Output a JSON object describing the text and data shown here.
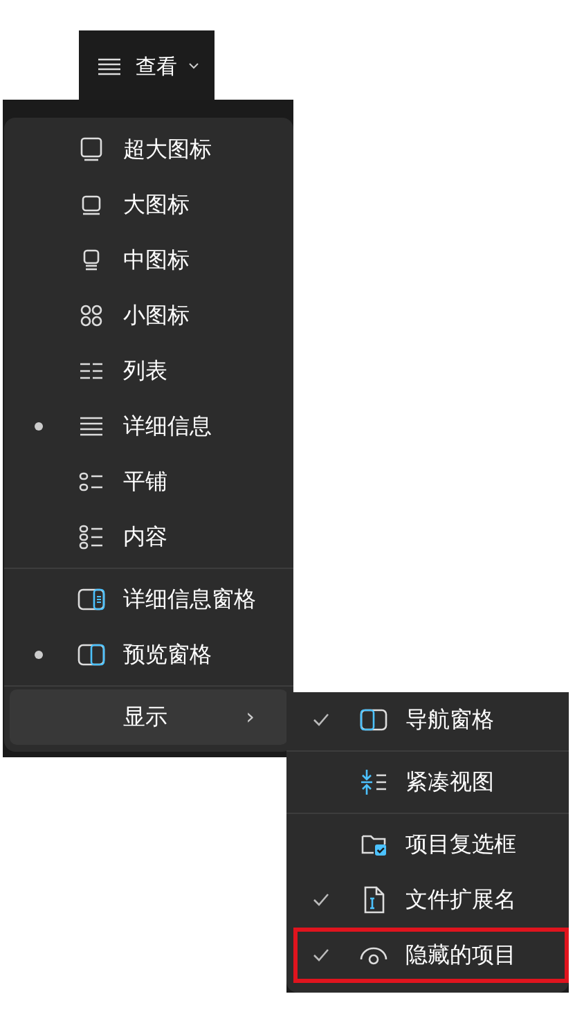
{
  "toolbar": {
    "label": "查看",
    "expanded": true
  },
  "view_menu": {
    "items": [
      {
        "kind": "option",
        "label": "超大图标",
        "selected": false
      },
      {
        "kind": "option",
        "label": "大图标",
        "selected": false
      },
      {
        "kind": "option",
        "label": "中图标",
        "selected": false
      },
      {
        "kind": "option",
        "label": "小图标",
        "selected": false
      },
      {
        "kind": "option",
        "label": "列表",
        "selected": false
      },
      {
        "kind": "option",
        "label": "详细信息",
        "selected": true
      },
      {
        "kind": "option",
        "label": "平铺",
        "selected": false
      },
      {
        "kind": "option",
        "label": "内容",
        "selected": false
      },
      {
        "kind": "divider"
      },
      {
        "kind": "option",
        "label": "详细信息窗格",
        "selected": false
      },
      {
        "kind": "option",
        "label": "预览窗格",
        "selected": true
      },
      {
        "kind": "divider"
      },
      {
        "kind": "submenu",
        "label": "显示",
        "expanded": true,
        "arrow": "›"
      }
    ]
  },
  "show_menu": {
    "items": [
      {
        "kind": "toggle",
        "label": "导航窗格",
        "checked": true,
        "annotated": false
      },
      {
        "kind": "divider"
      },
      {
        "kind": "toggle",
        "label": "紧凑视图",
        "checked": false,
        "annotated": false
      },
      {
        "kind": "divider"
      },
      {
        "kind": "toggle",
        "label": "项目复选框",
        "checked": false,
        "annotated": false
      },
      {
        "kind": "toggle",
        "label": "文件扩展名",
        "checked": true,
        "annotated": false
      },
      {
        "kind": "toggle",
        "label": "隐藏的项目",
        "checked": true,
        "annotated": true
      }
    ]
  }
}
